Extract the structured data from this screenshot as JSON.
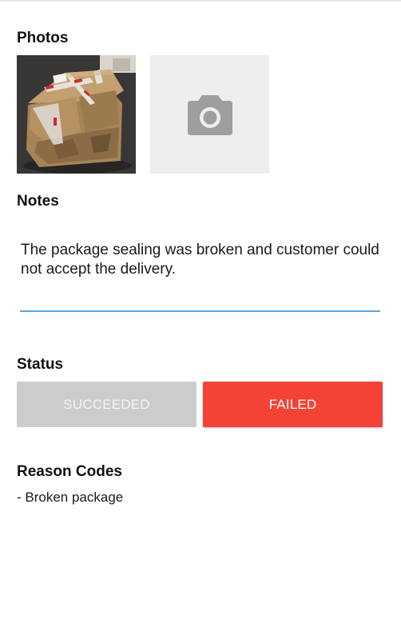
{
  "photos": {
    "title": "Photos",
    "thumbnail_icon": "damaged-package-photo",
    "add_photo_icon": "camera-icon"
  },
  "notes": {
    "title": "Notes",
    "value": "The package sealing was broken and customer could not accept the delivery."
  },
  "status": {
    "title": "Status",
    "succeeded_label": "SUCCEEDED",
    "failed_label": "FAILED",
    "selected": "FAILED"
  },
  "reason_codes": {
    "title": "Reason Codes",
    "items": [
      "- Broken package"
    ]
  },
  "colors": {
    "failed": "#f44336",
    "unselected": "#cccccc",
    "underline": "#5aa9e0",
    "photo_placeholder": "#eeeeee",
    "camera_icon": "#9e9e9e"
  }
}
